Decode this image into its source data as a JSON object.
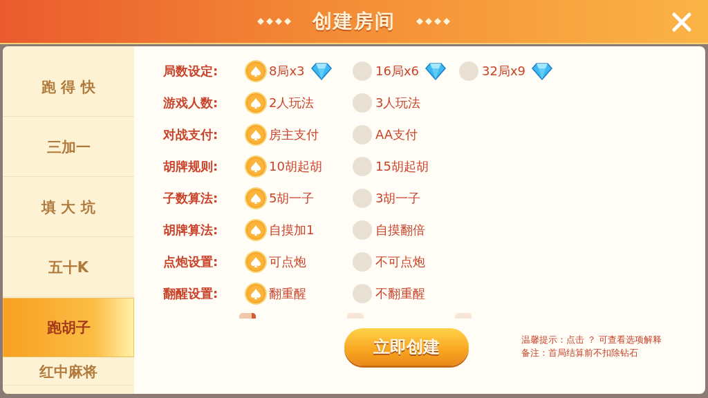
{
  "window": {
    "title": "创建房间"
  },
  "sidebar": {
    "items": [
      {
        "label": "跑 得 快",
        "selected": false
      },
      {
        "label": "三加一",
        "selected": false
      },
      {
        "label": "填 大 坑",
        "selected": false
      },
      {
        "label": "五十K",
        "selected": false
      },
      {
        "label": "跑胡子",
        "selected": true
      },
      {
        "label": "红中麻将",
        "selected": false
      }
    ]
  },
  "settings": [
    {
      "label": "局数设定:",
      "options": [
        {
          "text": "8局x3",
          "selected": true,
          "diamond": true
        },
        {
          "text": "16局x6",
          "selected": false,
          "diamond": true
        },
        {
          "text": "32局x9",
          "selected": false,
          "diamond": true
        }
      ]
    },
    {
      "label": "游戏人数:",
      "options": [
        {
          "text": "2人玩法",
          "selected": true
        },
        {
          "text": "3人玩法",
          "selected": false
        }
      ]
    },
    {
      "label": "对战支付:",
      "options": [
        {
          "text": "房主支付",
          "selected": true
        },
        {
          "text": "AA支付",
          "selected": false
        }
      ]
    },
    {
      "label": "胡牌规则:",
      "options": [
        {
          "text": "10胡起胡",
          "selected": true
        },
        {
          "text": "15胡起胡",
          "selected": false
        }
      ]
    },
    {
      "label": "子数算法:",
      "options": [
        {
          "text": "5胡一子",
          "selected": true
        },
        {
          "text": "3胡一子",
          "selected": false
        }
      ]
    },
    {
      "label": "胡牌算法:",
      "options": [
        {
          "text": "自摸加1",
          "selected": true
        },
        {
          "text": "自摸翻倍",
          "selected": false
        }
      ]
    },
    {
      "label": "点炮设置:",
      "options": [
        {
          "text": "可点炮",
          "selected": true
        },
        {
          "text": "不可点炮",
          "selected": false
        }
      ]
    },
    {
      "label": "翻醒设置:",
      "options": [
        {
          "text": "翻重醒",
          "selected": true
        },
        {
          "text": "不翻重醒",
          "selected": false
        }
      ]
    }
  ],
  "partial_checkboxes": [
    {
      "checked": true
    },
    {
      "checked": false
    },
    {
      "checked": false
    }
  ],
  "create_button": "立即创建",
  "tips": [
    "温馨提示：点击 ？  可查看选项解释",
    "备注：首局结算前不扣除钻石"
  ]
}
